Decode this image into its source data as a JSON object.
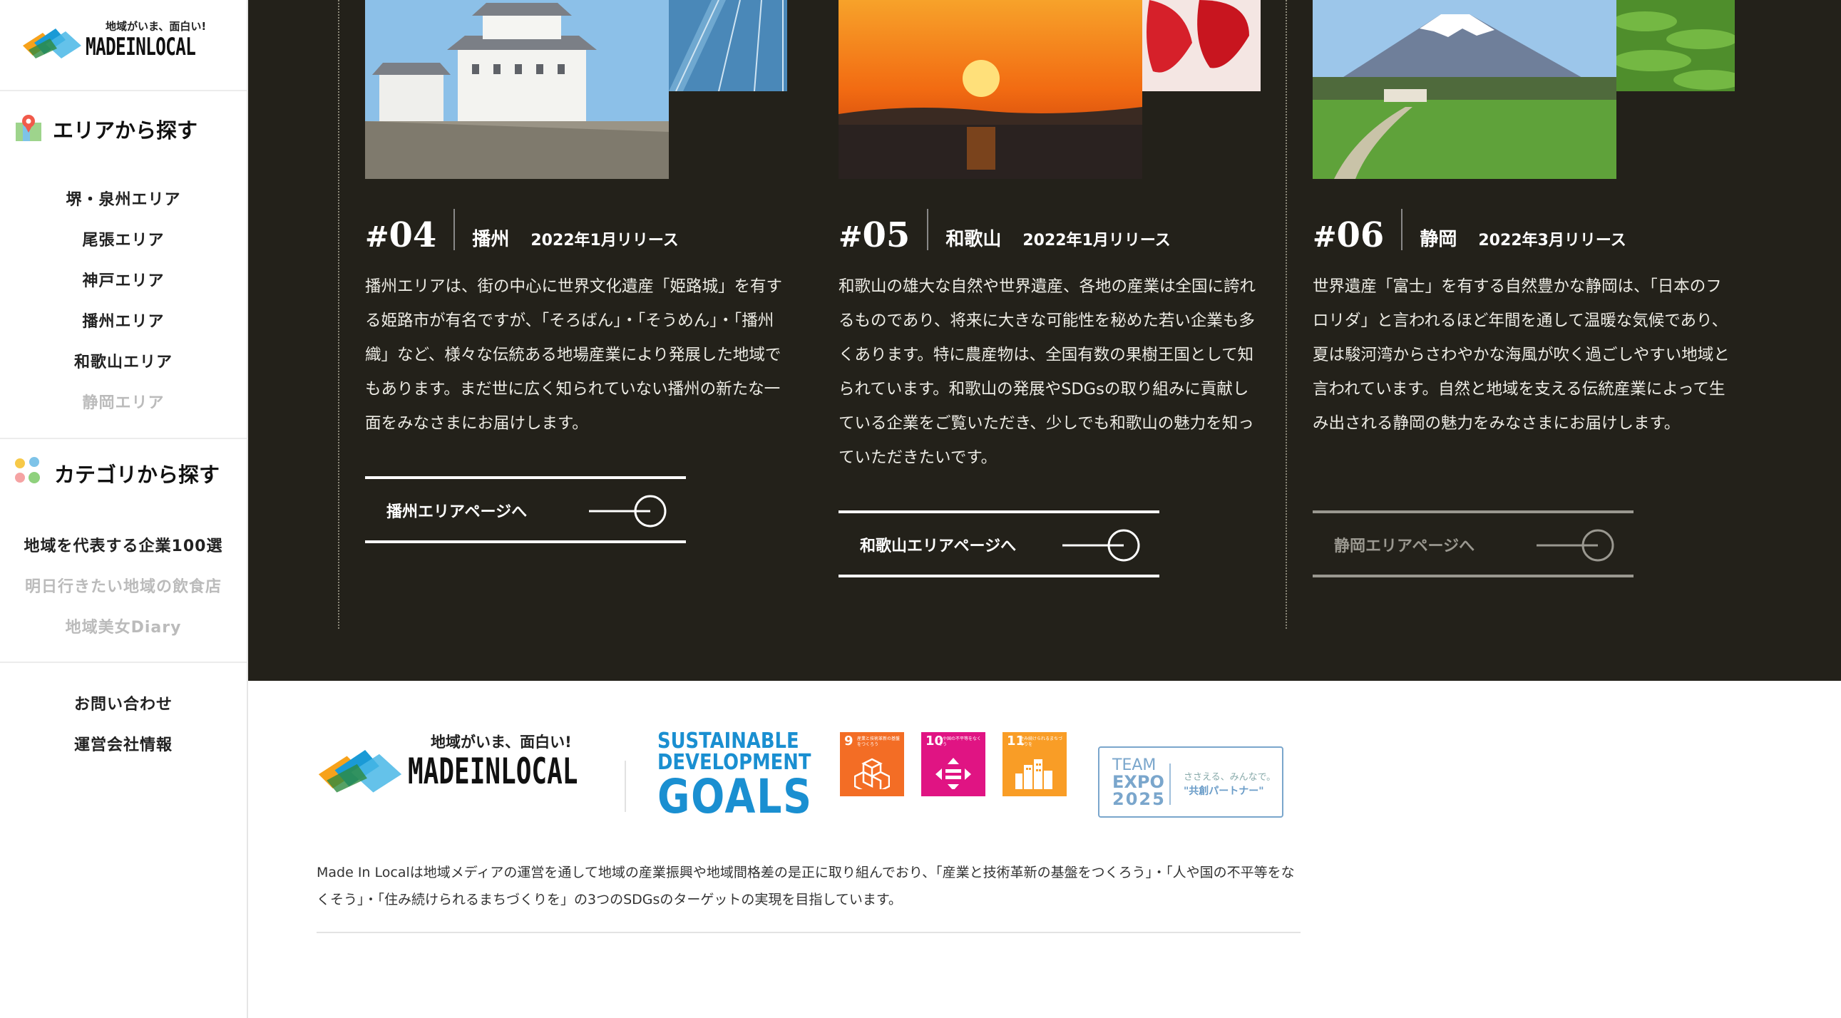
{
  "sidebar": {
    "logo": {
      "tagline": "地域がいま、面白い!",
      "wordmark": "MADEINLOCAL"
    },
    "area_section": {
      "title": "エリアから探す",
      "items": [
        {
          "label": "堺・泉州エリア"
        },
        {
          "label": "尾張エリア"
        },
        {
          "label": "神戸エリア"
        },
        {
          "label": "播州エリア"
        },
        {
          "label": "和歌山エリア"
        },
        {
          "label": "静岡エリア"
        }
      ]
    },
    "category_section": {
      "title": "カテゴリから探す",
      "items": [
        {
          "label": "地域を代表する企業100選"
        },
        {
          "label": "明日行きたい地域の飲食店"
        },
        {
          "label": "地域美女Diary"
        }
      ]
    },
    "footer_links": [
      {
        "label": "お問い合わせ"
      },
      {
        "label": "運営会社情報"
      }
    ]
  },
  "areas": [
    {
      "hash": "#",
      "number": "04",
      "name": "播州",
      "release": "2022年1月リリース",
      "description": "播州エリアは、街の中心に世界文化遺産「姫路城」を有する姫路市が有名ですが、「そろばん」・「そうめん」・「播州織」など、様々な伝統ある地場産業により発展した地域でもあります。まだ世に広く知られていない播州の新たな一面をみなさまにお届けします。",
      "cta": "播州エリアページへ"
    },
    {
      "hash": "#",
      "number": "05",
      "name": "和歌山",
      "release": "2022年1月リリース",
      "description": "和歌山の雄大な自然や世界遺産、各地の産業は全国に誇れるものであり、将来に大きな可能性を秘めた若い企業も多くあります。特に農産物は、全国有数の果樹王国として知られています。和歌山の発展やSDGsの取り組みに貢献している企業をご覧いただき、少しでも和歌山の魅力を知っていただきたいです。",
      "cta": "和歌山エリアページへ"
    },
    {
      "hash": "#",
      "number": "06",
      "name": "静岡",
      "release": "2022年3月リリース",
      "description": "世界遺産「富士」を有する自然豊かな静岡は、「日本のフロリダ」と言われるほど年間を通して温暖な気候であり、夏は駿河湾からさわやかな海風が吹く過ごしやすい地域と言われています。自然と地域を支える伝統産業によって生み出される静岡の魅力をみなさまにお届けします。",
      "cta": "静岡エリアページへ"
    }
  ],
  "footer": {
    "logo": {
      "tagline": "地域がいま、面白い!",
      "wordmark": "MADEINLOCAL"
    },
    "sdgs": {
      "line1": "SUSTAINABLE",
      "line2": "DEVELOPMENT",
      "line3": "GOALS"
    },
    "goals": [
      {
        "number": "9",
        "text": "産業と技術革新の基盤をつくろう",
        "color": "#f36d25"
      },
      {
        "number": "10",
        "text": "人や国の不平等をなくそう",
        "color": "#e01483"
      },
      {
        "number": "11",
        "text": "住み続けられるまちづくりを",
        "color": "#f99d26"
      }
    ],
    "expo": {
      "team": "TEAM",
      "expo": "EXPO",
      "year": "2025",
      "sub": "ささえる、みんなで。",
      "partner": "\"共創パートナー\""
    },
    "description": "Made In Localは地域メディアの運営を通して地域の産業振興や地域間格差の是正に取り組んでおり、「産業と技術革新の基盤をつくろう」・「人や国の不平等をなくそう」・「住み続けられるまちづくりを」の3つのSDGsのターゲットの実現を目指しています。"
  },
  "colors": {
    "dark_bg": "#23211a",
    "sdgs_blue": "#1a8fd1",
    "expo_blue": "#7aa6cc"
  }
}
